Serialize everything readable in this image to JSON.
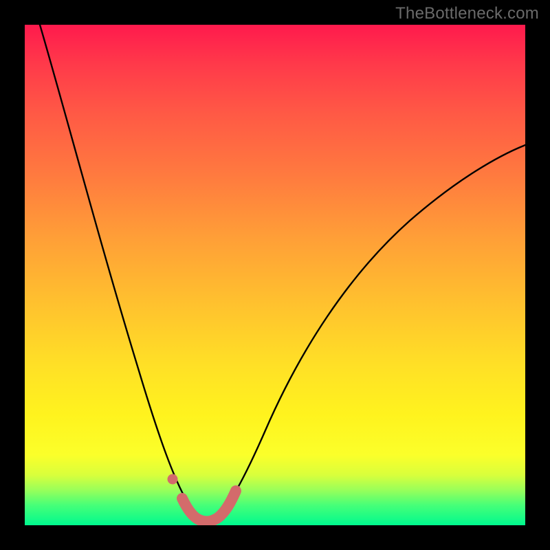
{
  "watermark": "TheBottleneck.com",
  "colors": {
    "frame": "#000000",
    "curve": "#000000",
    "marker": "#d36b6b",
    "gradient_stops": [
      "#ff1a4d",
      "#ff7a3f",
      "#ffe026",
      "#00f98e"
    ]
  },
  "chart_data": {
    "type": "line",
    "title": "",
    "xlabel": "",
    "ylabel": "",
    "xlim": [
      0,
      100
    ],
    "ylim": [
      0,
      100
    ],
    "curve_description": "V-shaped bottleneck curve: value drops steeply from left edge to ~0 at the minimum, then rises toward the right edge with decreasing slope",
    "x": [
      3,
      5,
      8,
      12,
      16,
      20,
      24,
      27,
      29,
      30.5,
      32,
      33.5,
      35,
      36.5,
      38,
      40,
      43,
      47,
      52,
      58,
      65,
      73,
      82,
      92,
      100
    ],
    "values": [
      100,
      90,
      78,
      64,
      51,
      39,
      27,
      17,
      10,
      6,
      3,
      1.2,
      0.5,
      1.2,
      3,
      6,
      12,
      20,
      29,
      38,
      47,
      55,
      62,
      68,
      72
    ],
    "minimum_x": 35,
    "markers": {
      "description": "salmon-colored highlighted segment near curve minimum",
      "points": [
        {
          "x": 29.5,
          "y": 8
        },
        {
          "x": 32,
          "y": 1.5
        },
        {
          "x": 34,
          "y": 0.6
        },
        {
          "x": 36,
          "y": 0.6
        },
        {
          "x": 38,
          "y": 1.5
        },
        {
          "x": 40.5,
          "y": 6
        }
      ]
    }
  }
}
